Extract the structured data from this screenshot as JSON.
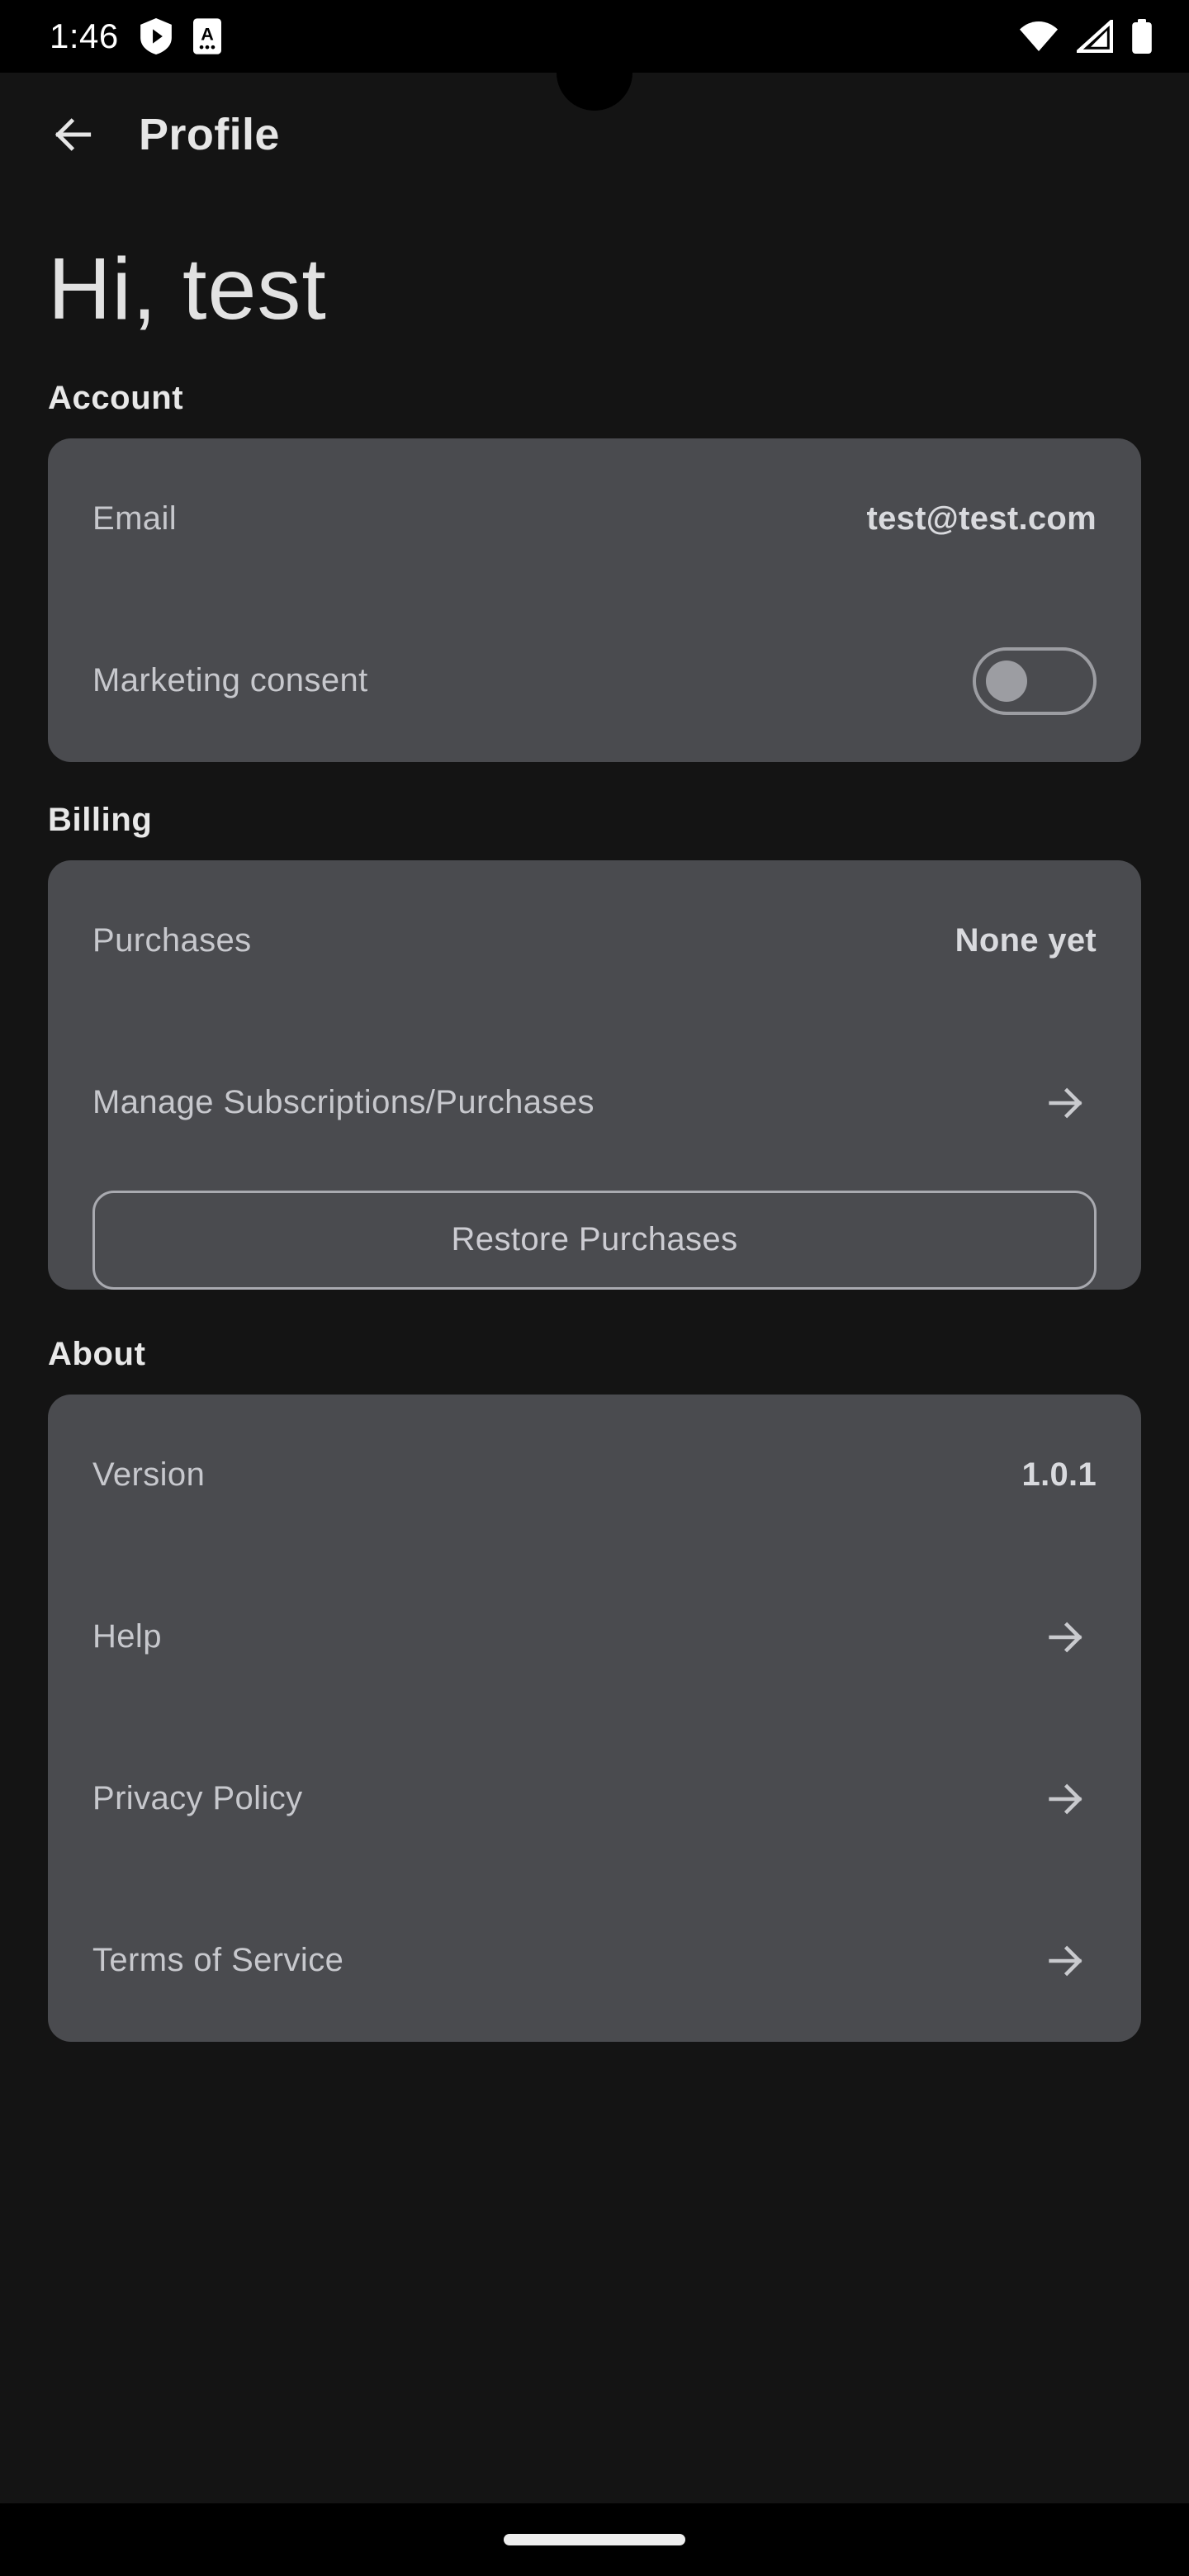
{
  "status_bar": {
    "time": "1:46",
    "left_icons": [
      "play-shield-icon",
      "text-badge-icon"
    ],
    "right_icons": [
      "wifi-icon",
      "cellular-signal-icon",
      "battery-icon"
    ]
  },
  "app_bar": {
    "back_icon": "arrow-left-icon",
    "title": "Profile"
  },
  "greeting": "Hi, test",
  "sections": {
    "account": {
      "title": "Account",
      "email_label": "Email",
      "email_value": "test@test.com",
      "marketing_label": "Marketing consent",
      "marketing_enabled": false
    },
    "billing": {
      "title": "Billing",
      "purchases_label": "Purchases",
      "purchases_value": "None yet",
      "manage_label": "Manage Subscriptions/Purchases",
      "manage_icon": "arrow-right-icon",
      "restore_label": "Restore Purchases"
    },
    "about": {
      "title": "About",
      "version_label": "Version",
      "version_value": "1.0.1",
      "help_label": "Help",
      "help_icon": "arrow-right-icon",
      "privacy_label": "Privacy Policy",
      "privacy_icon": "arrow-right-icon",
      "terms_label": "Terms of Service",
      "terms_icon": "arrow-right-icon"
    }
  },
  "colors": {
    "background": "#141414",
    "card": "#4a4b4f",
    "label": "#c7c8cd",
    "value": "#d9dade",
    "heading": "#e8e8e8",
    "outline": "#a9aab0",
    "status_bar": "#000000"
  }
}
